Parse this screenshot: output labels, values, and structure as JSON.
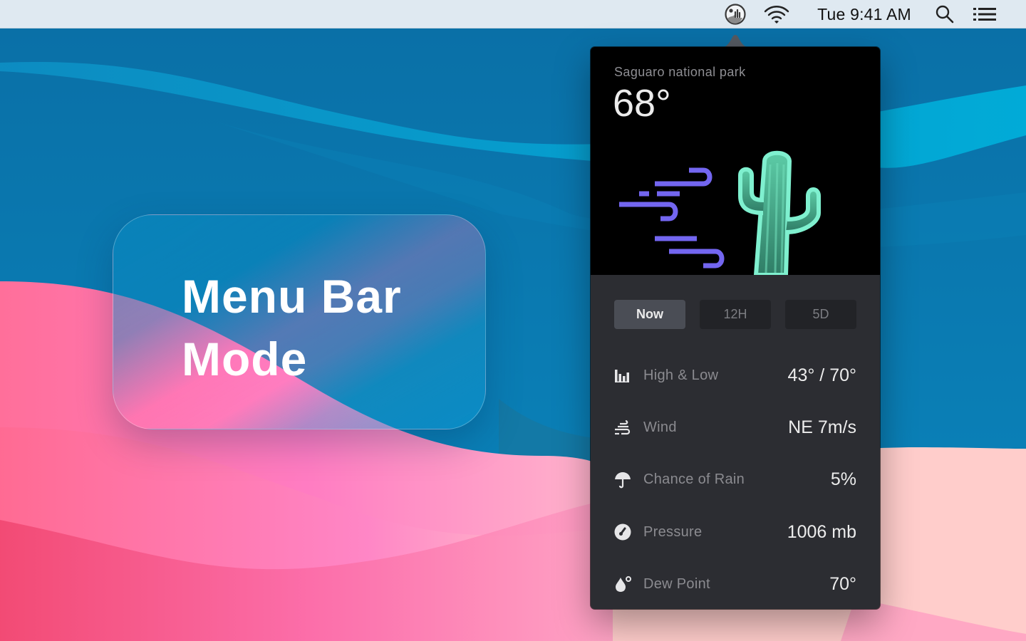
{
  "menubar": {
    "weather_icon": "weather-app-icon",
    "wifi_icon": "wifi-icon",
    "clock": "Tue 9:41 AM",
    "search_icon": "spotlight-search-icon",
    "list_icon": "notification-center-icon"
  },
  "title_card": {
    "line1": "Menu Bar",
    "line2": "Mode"
  },
  "popover": {
    "location": "Saguaro national park",
    "current_temp": "68°",
    "illustration": "wind-and-cactus",
    "tabs": [
      {
        "label": "Now",
        "active": true
      },
      {
        "label": "12H",
        "active": false
      },
      {
        "label": "5D",
        "active": false
      }
    ],
    "details": [
      {
        "icon": "bar-chart-icon",
        "label": "High & Low",
        "value": "43° / 70°"
      },
      {
        "icon": "wind-icon",
        "label": "Wind",
        "value": "NE 7m/s"
      },
      {
        "icon": "umbrella-icon",
        "label": "Chance of Rain",
        "value": "5%"
      },
      {
        "icon": "gauge-icon",
        "label": "Pressure",
        "value": "1006 mb"
      },
      {
        "icon": "dew-drop-icon",
        "label": "Dew Point",
        "value": "70°"
      }
    ]
  },
  "colors": {
    "wind_purple": "#7366f0",
    "cactus_green": "#7ff0cf",
    "cactus_body": "#3f9f84",
    "popover_bg": "#2c2d32",
    "hero_bg": "#000000",
    "active_tab": "#4a4d55"
  }
}
